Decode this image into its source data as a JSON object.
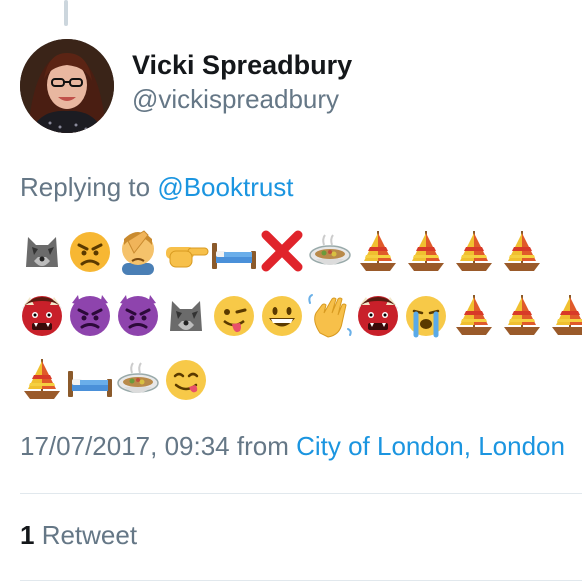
{
  "tweet": {
    "author": {
      "display_name": "Vicki Spreadbury",
      "handle": "@vickispreadbury"
    },
    "replying_prefix": "Replying to ",
    "replying_to": "@Booktrust",
    "emoji_rows": [
      [
        "wolf",
        "angry-face",
        "face-palm",
        "pointing-right",
        "bed",
        "cross-mark",
        "stew",
        "sailboat",
        "sailboat",
        "sailboat",
        "sailboat"
      ],
      [
        "ogre",
        "imp",
        "imp",
        "wolf",
        "winking-tongue",
        "grinning-face",
        "waving-hand",
        "ogre",
        "crying-face",
        "sailboat",
        "sailboat",
        "sailboat"
      ],
      [
        "sailboat",
        "bed",
        "stew",
        "yum-face"
      ]
    ],
    "timestamp": "17/07/2017, 09:34",
    "from_word": " from ",
    "location": "City of London, London",
    "retweet_count": "1",
    "retweet_label": " Retweet"
  }
}
